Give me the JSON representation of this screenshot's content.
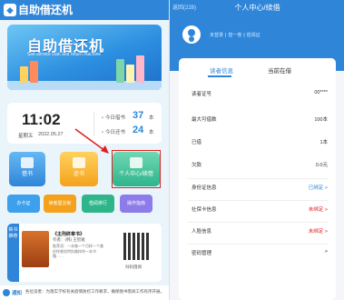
{
  "left": {
    "app_title": "自助借还机",
    "banner": {
      "title": "自助借还机",
      "subtitle": "Self service loan and return machine"
    },
    "clock": {
      "time": "11:02",
      "weekday": "星期五",
      "date": "2022.05.27"
    },
    "stats": [
      {
        "label": "今日借书",
        "value": "37",
        "unit": "本"
      },
      {
        "label": "今日还书",
        "value": "24",
        "unit": "本"
      }
    ],
    "tiles": [
      {
        "label": "借书",
        "icon": "book-icon"
      },
      {
        "label": "还书",
        "icon": "return-icon"
      },
      {
        "label": "个人中心/续借",
        "icon": "user-center-icon"
      }
    ],
    "small_buttons": [
      {
        "label": "办卡证"
      },
      {
        "label": "读者留言板"
      },
      {
        "label": "借阅排行"
      },
      {
        "label": "操作指南"
      }
    ],
    "new_book": {
      "tag": "新书推荐",
      "title": "《主刑终章书》",
      "author": "作者：(韩) 王智雅",
      "desc": "推荐语：一本像一个月样一个美好样感觉特别美样的一本书籍……",
      "qr_label": "扫码借阅"
    },
    "notice": {
      "label": "通知",
      "text": "各位读者：为落实学校有关疫情防控工作要求，确保图书借阅工作有序开展，"
    }
  },
  "right": {
    "back_label": "返回(228)",
    "title": "个人中心/续借",
    "user": {
      "name": "未登录",
      "id": "借一卷",
      "card": "借阅证"
    },
    "tabs": [
      {
        "label": "读者信息",
        "active": true
      },
      {
        "label": "当前在借",
        "active": false
      }
    ],
    "info_rows": [
      {
        "key": "读者证号",
        "value": "00****"
      },
      {
        "key": "最大可借数",
        "value": "100本"
      },
      {
        "key": "已借",
        "value": "1本"
      },
      {
        "key": "欠款",
        "value": "0.0元"
      }
    ],
    "link_rows": [
      {
        "key": "身份证信息",
        "value": "已绑定 >",
        "status": "ok"
      },
      {
        "key": "社保卡信息",
        "value": "未绑定 >",
        "status": "bad"
      },
      {
        "key": "人脸信息",
        "value": "未绑定 >",
        "status": "bad"
      },
      {
        "key": "密码管理",
        "value": ">",
        "status": "none"
      }
    ]
  },
  "colors": {
    "primary": "#2f86d9",
    "accent_yellow": "#f4a21c",
    "accent_green": "#2fb58a",
    "accent_purple": "#8d7bea",
    "highlight_red": "#e02020"
  }
}
